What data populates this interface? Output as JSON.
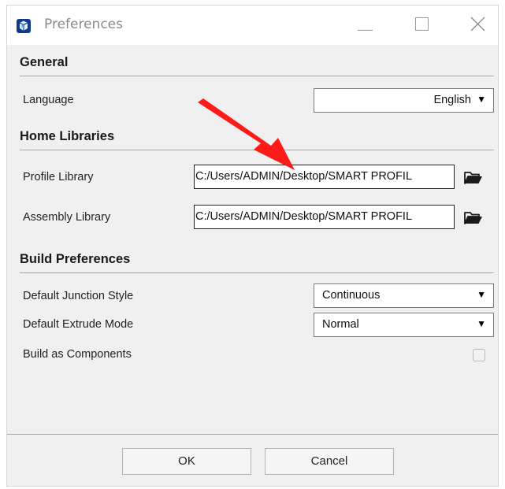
{
  "window": {
    "title": "Preferences",
    "icon": "sketchup-app-icon",
    "controls": [
      "minimize-icon",
      "maximize-icon",
      "close-icon"
    ]
  },
  "general": {
    "heading": "General",
    "language_label": "Language",
    "language_value": "English"
  },
  "home_libraries": {
    "heading": "Home Libraries",
    "profile_label": "Profile Library",
    "profile_path": "C:/Users/ADMIN/Desktop/SMART PROFIL",
    "assembly_label": "Assembly Library",
    "assembly_path": "C:/Users/ADMIN/Desktop/SMART PROFIL",
    "browse_icon": "folder-open-icon"
  },
  "build_preferences": {
    "heading": "Build Preferences",
    "junction_label": "Default Junction Style",
    "junction_value": "Continuous",
    "extrude_label": "Default Extrude Mode",
    "extrude_value": "Normal",
    "components_label": "Build as Components",
    "components_checked": false
  },
  "dropdown_arrow": "▼",
  "buttons": {
    "ok": "OK",
    "cancel": "Cancel"
  },
  "annotation": {
    "type": "arrow",
    "color": "#ff1a1a"
  }
}
